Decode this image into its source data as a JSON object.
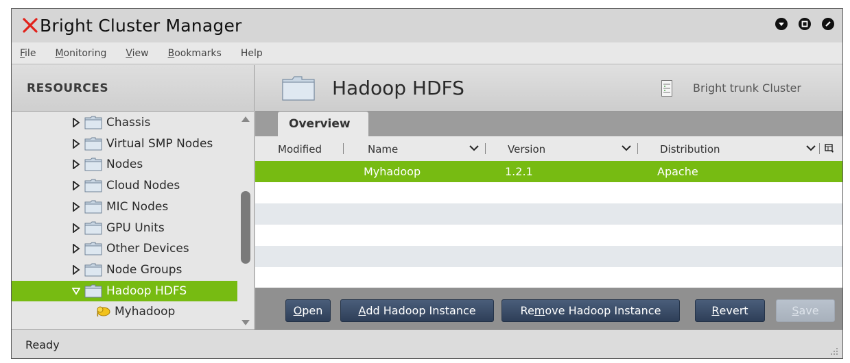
{
  "app": {
    "title": "Bright Cluster Manager"
  },
  "menu": [
    {
      "label": "File",
      "mnemonic": "F",
      "rest": "ile"
    },
    {
      "label": "Monitoring",
      "mnemonic": "M",
      "rest": "onitoring"
    },
    {
      "label": "View",
      "mnemonic": "V",
      "rest": "iew"
    },
    {
      "label": "Bookmarks",
      "mnemonic": "B",
      "rest": "ookmarks"
    },
    {
      "label": "Help",
      "mnemonic": "",
      "rest": "Help"
    }
  ],
  "resources": {
    "title": "RESOURCES",
    "tree": [
      {
        "label": "Chassis",
        "icon": "folder-icon"
      },
      {
        "label": "Virtual SMP Nodes",
        "icon": "folder-icon"
      },
      {
        "label": "Nodes",
        "icon": "folder-icon"
      },
      {
        "label": "Cloud Nodes",
        "icon": "folder-icon"
      },
      {
        "label": "MIC Nodes",
        "icon": "folder-icon"
      },
      {
        "label": "GPU Units",
        "icon": "folder-icon"
      },
      {
        "label": "Other Devices",
        "icon": "folder-icon"
      },
      {
        "label": "Node Groups",
        "icon": "folder-icon"
      },
      {
        "label": "Hadoop HDFS",
        "icon": "folder-icon",
        "selected": true,
        "expanded": true
      },
      {
        "label": "Myhadoop",
        "icon": "hadoop-elephant-icon",
        "child": true
      }
    ]
  },
  "main": {
    "title": "Hadoop HDFS",
    "cluster": "Bright trunk Cluster",
    "tab": "Overview",
    "columns": [
      "Modified",
      "Name",
      "Version",
      "Distribution"
    ],
    "rows": [
      {
        "modified": "",
        "name": "Myhadoop",
        "version": "1.2.1",
        "distribution": "Apache"
      }
    ],
    "buttons": {
      "open": {
        "mn": "O",
        "rest": "pen"
      },
      "add": {
        "mn": "A",
        "rest": "dd Hadoop Instance"
      },
      "remove": {
        "pre": "Re",
        "mn": "m",
        "rest": "ove Hadoop Instance"
      },
      "revert": {
        "mn": "R",
        "rest": "evert"
      },
      "save": {
        "mn": "S",
        "rest": "ave"
      }
    }
  },
  "status": {
    "text": "Ready"
  },
  "colors": {
    "accent": "#77bb12",
    "button": "#3a4d68"
  }
}
